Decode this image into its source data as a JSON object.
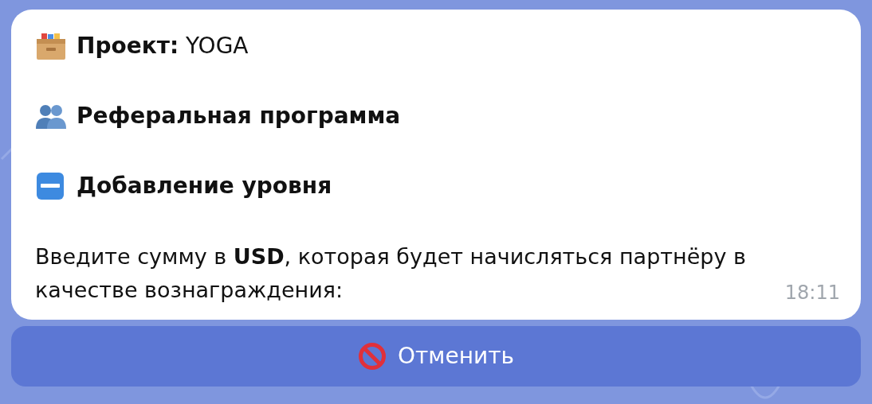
{
  "message": {
    "lines": [
      {
        "kind": "project",
        "bold": false,
        "text": "**Проект:** YOGA"
      },
      {
        "kind": "referral",
        "bold": true,
        "text": "Реферальная программа"
      },
      {
        "kind": "new",
        "bold": true,
        "text": "Добавление уровня"
      }
    ],
    "body": "Введите сумму в **USD**, которая будет начисляться партнёру в качестве вознаграждения:",
    "time": "18:11"
  },
  "keyboard": [
    {
      "kind": "cancel",
      "label": "Отменить"
    }
  ]
}
